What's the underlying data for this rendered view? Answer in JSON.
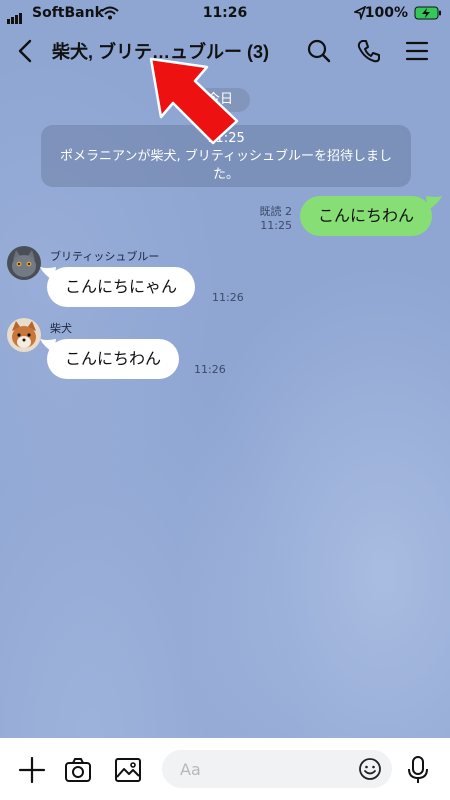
{
  "status_bar": {
    "carrier": "SoftBank",
    "time": "11:26",
    "battery": "100%"
  },
  "header": {
    "title": "柴犬, ブリテ…ュブルー (3)"
  },
  "chat": {
    "date_label": "今日",
    "system_message": {
      "time": "11:25",
      "text": "ポメラニアンが柴犬, ブリティッシュブルーを招待しました。"
    },
    "messages": [
      {
        "side": "right",
        "text": "こんにちわん",
        "read": "既読 2",
        "time": "11:25"
      },
      {
        "side": "left",
        "sender": "ブリティッシュブルー",
        "text": "こんにちにゃん",
        "time": "11:26"
      },
      {
        "side": "left",
        "sender": "柴犬",
        "text": "こんにちわん",
        "time": "11:26"
      }
    ]
  },
  "composer": {
    "placeholder": "Aa"
  },
  "icons": {
    "back": "chevron-left-icon",
    "search": "search-icon",
    "call": "phone-icon",
    "menu": "hamburger-menu-icon",
    "add": "plus-icon",
    "camera": "camera-icon",
    "image": "image-icon",
    "emoji": "smiley-icon",
    "mic": "microphone-icon"
  },
  "colors": {
    "background": "#8fa6d3",
    "my_bubble": "#86de75",
    "their_bubble": "#ffffff",
    "annotation_arrow": "#ee1111"
  }
}
